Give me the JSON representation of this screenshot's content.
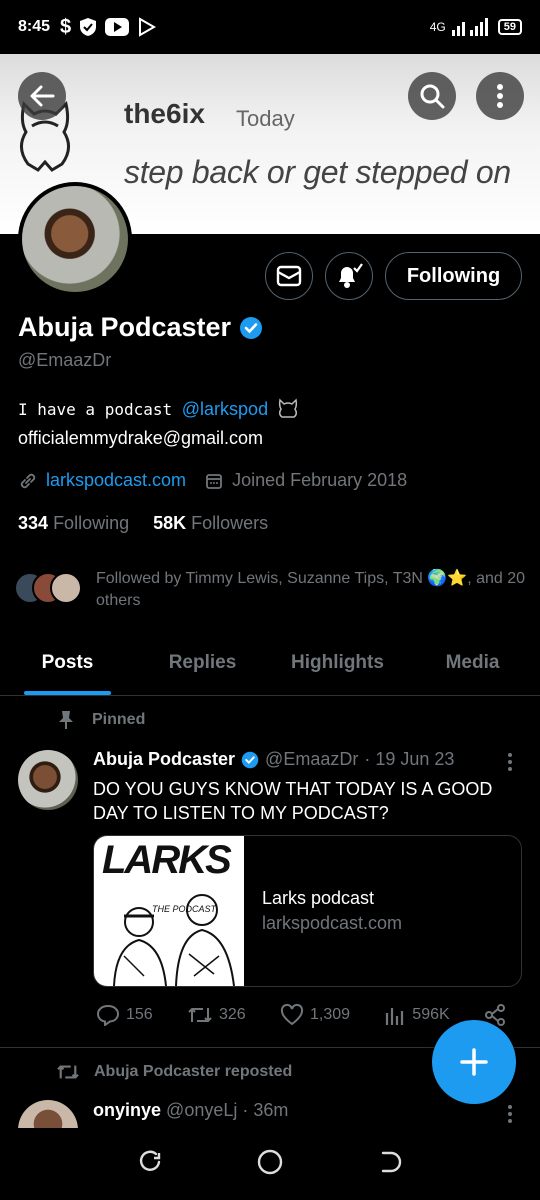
{
  "status_bar": {
    "time": "8:45",
    "network": "4G",
    "battery": "59"
  },
  "banner": {
    "title": "the6ix",
    "date": "Today",
    "slogan": "step back or get stepped on"
  },
  "profile": {
    "name": "Abuja Podcaster",
    "handle": "@EmaazDr",
    "bio_text": "I have a podcast ",
    "bio_link": "@larkspod",
    "email": "officialemmydrake@gmail.com",
    "website": "larkspodcast.com",
    "joined": "Joined February 2018",
    "following_count": "334",
    "following_label": "Following",
    "followers_count": "58K",
    "followers_label": "Followers",
    "followed_by": "Followed by Timmy Lewis, Suzanne Tips, T3N 🌍⭐, and 20 others",
    "follow_button": "Following"
  },
  "tabs": [
    {
      "label": "Posts",
      "active": true
    },
    {
      "label": "Replies",
      "active": false
    },
    {
      "label": "Highlights",
      "active": false
    },
    {
      "label": "Media",
      "active": false
    }
  ],
  "pinned_post": {
    "pinned_label": "Pinned",
    "author": "Abuja Podcaster",
    "handle": "@EmaazDr",
    "date": "· 19 Jun 23",
    "text": "DO YOU GUYS KNOW THAT TODAY IS A GOOD DAY TO LISTEN TO MY PODCAST?",
    "card": {
      "image_text": "LARKS",
      "image_subtext": "THE PODCAST",
      "title": "Larks podcast",
      "url": "larkspodcast.com"
    },
    "replies": "156",
    "reposts": "326",
    "likes": "1,309",
    "views": "596K"
  },
  "repost": {
    "label": "Abuja Podcaster reposted",
    "author": "onyinye",
    "handle": "@onyeLj",
    "time": "· 36m"
  },
  "colors": {
    "accent": "#1d9bf0",
    "muted": "#71767b",
    "background": "#000000"
  }
}
